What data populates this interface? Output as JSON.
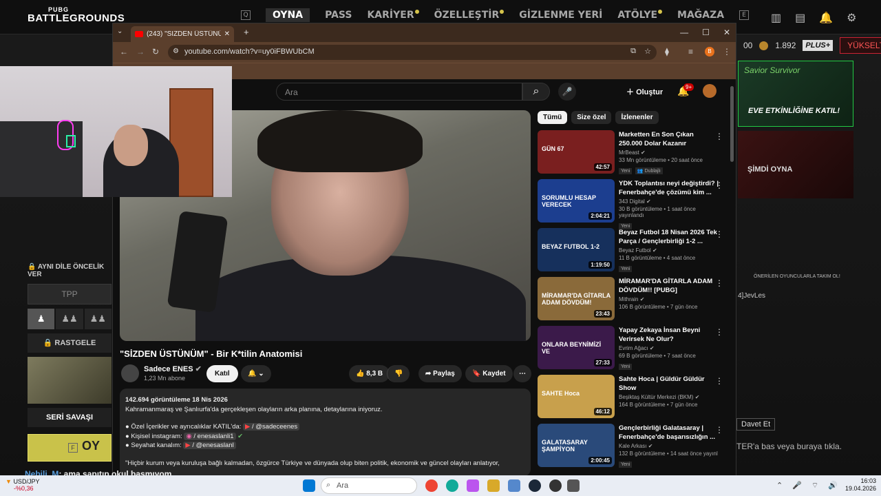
{
  "game": {
    "logo_small": "PUBG",
    "logo_big": "BATTLEGROUNDS",
    "nav_keys": [
      "Q",
      "E"
    ],
    "nav": [
      "OYNA",
      "PASS",
      "KARİYER",
      "ÖZELLEŞTİR",
      "GİZLENME YERİ",
      "ATÖLYE",
      "MAĞAZA"
    ],
    "coins_prefix": "00",
    "coins": "1.892",
    "plus_label": "PLUS+",
    "upgrade": "YÜKSELT",
    "banner1_top": "Savior Survivor",
    "banner1_bottom": "EVE ETKİNLİĞİNE KATIL!",
    "banner2_bottom": "ŞİMDİ OYNA",
    "recommended": "ÖNERİLEN OYUNCULARLA TAKIM OL!",
    "player_name": "4]JevLes",
    "invite": "Davet Et",
    "press_hint": "TER'a bas veya buraya tıkla.",
    "lang_priority": "AYNI DİLE ÖNCELİK VER",
    "mode": "TPP",
    "random": "RASTGELE",
    "seri": "SERİ SAVAŞI",
    "oyna_key": "F",
    "oyna_btn": "OY"
  },
  "chat": {
    "name": "Nebili_M",
    "text": ": ama sapıtıp okul basmıyom"
  },
  "browser": {
    "tab_title": "(243) \"SİZDEN ÜSTÜNÜM\" - Bir",
    "url": "youtube.com/watch?v=uy0iFBWUbCM",
    "profile_letter": "B"
  },
  "youtube": {
    "search_placeholder": "Ara",
    "create": "Oluştur",
    "notif_count": "9+",
    "title": "\"SİZDEN ÜSTÜNÜM\" - Bir K*tilin Anatomisi",
    "channel": "Sadece ENES",
    "subs": "1,23 Mn abone",
    "join": "Katıl",
    "likes": "8,3 B",
    "share": "Paylaş",
    "save": "Kaydet",
    "views_date": "142.694 görüntüleme  18 Nis 2026",
    "desc_line1": "Kahramanmaraş ve Şanlıurfa'da gerçekleşen olayların arka planına, detaylarına iniyoruz.",
    "desc_b1_label": "● Özel İçerikler ve ayrıcalıklar KATIL'da: ",
    "desc_b1_val": " / @sadeceenes",
    "desc_b2_label": "● Kişisel instagram: ",
    "desc_b2_val": " / enesaslanli1",
    "desc_b3_label": "● Seyahat kanalım: ",
    "desc_b3_val": " / @enesaslanl",
    "desc_quote": "\"Hiçbir kurum veya kuruluşa bağlı kalmadan, özgürce Türkiye ve dünyada olup biten politik, ekonomik ve güncel olayları anlatıyor,",
    "chips": [
      "Tümü",
      "Size özel",
      "İzlenenler"
    ],
    "recs": [
      {
        "title": "Marketten En Son Çıkan 250.000 Dolar Kazanır",
        "channel": "MrBeast",
        "meta": "33 Mn görüntüleme • 20 saat önce",
        "dur": "42:57",
        "badge": "Yeni",
        "badge2": "Dublajlı",
        "thumb_text": "GÜN 67"
      },
      {
        "title": "YDK Toplantısı neyi değiştirdi? | Fenerbahçe'de çözümü kim ...",
        "channel": "343 Digital",
        "meta": "30 B görüntüleme • 1 saat önce yayınlandı",
        "dur": "2:04:21",
        "badge": "Yeni",
        "thumb_text": "SORUMLU HESAP VERECEK"
      },
      {
        "title": "Beyaz Futbol 18 Nisan 2026 Tek Parça /  Gençlerbirliği 1-2 ...",
        "channel": "Beyaz Futbol",
        "meta": "11 B görüntüleme • 4 saat önce",
        "dur": "1:19:50",
        "badge": "Yeni",
        "thumb_text": "BEYAZ FUTBOL 1-2"
      },
      {
        "title": "MİRAMAR'DA GİTARLA ADAM DÖVDÜM!! [PUBG]",
        "channel": "Mithrain",
        "meta": "106 B görüntüleme • 7 gün önce",
        "dur": "23:43",
        "thumb_text": "MİRAMAR'DA GİTARLA ADAM DÖVDÜM!"
      },
      {
        "title": "Yapay Zekaya İnsan Beyni Verirsek Ne Olur?",
        "channel": "Evrim Ağacı",
        "meta": "69 B görüntüleme • 7 saat önce",
        "dur": "27:33",
        "badge": "Yeni",
        "thumb_text": "ONLARA BEYNİMİZİ VE"
      },
      {
        "title": "Sahte Hoca | Güldür Güldür Show",
        "channel": "Beşiktaş Kültür Merkezi (BKM)",
        "meta": "164 B görüntüleme • 7 gün önce",
        "dur": "46:12",
        "thumb_text": "SAHTE Hoca"
      },
      {
        "title": "Gençlerbirliği Galatasaray | Fenerbahçe'de başarısızlığın ...",
        "channel": "Kale Arkası",
        "meta": "132 B görüntüleme • 14 saat önce yayınl",
        "dur": "2:00:45",
        "badge": "Yeni",
        "thumb_text": "GALATASARAY ŞAMPİYON"
      }
    ]
  },
  "taskbar": {
    "search": "Ara",
    "stock_name": "USD/JPY",
    "stock_change": "-%0,36",
    "time": "16:03",
    "date": "19.04.2026"
  },
  "colors": {
    "yt_red": "#ff0000",
    "accent_yellow": "#c9c24a",
    "pubg_red": "#cc2233"
  }
}
